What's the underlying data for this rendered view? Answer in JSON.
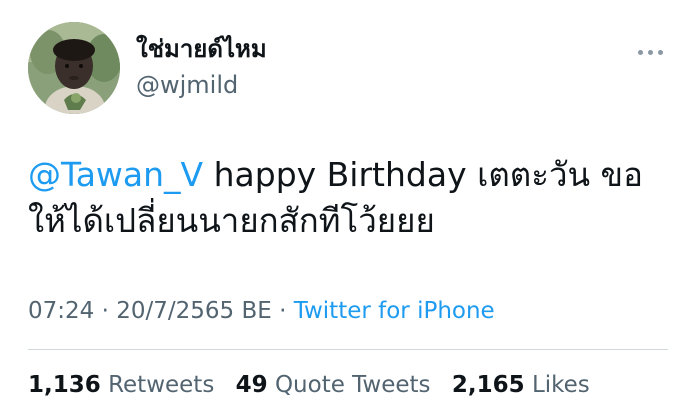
{
  "author": {
    "display_name": "ใช่มายด์ไหม",
    "handle": "@wjmild"
  },
  "tweet": {
    "mention": "@Tawan_V",
    "text_line1": " happy Birthday เตตะวัน ขอ",
    "text_line2": "ให้ได้เปลี่ยนนายกสักทีโว้ยยย"
  },
  "meta": {
    "time": "07:24",
    "separator": " · ",
    "date": "20/7/2565 BE",
    "source": "Twitter for iPhone"
  },
  "stats": {
    "retweets_count": "1,136",
    "retweets_label": "Retweets",
    "quotes_count": "49",
    "quotes_label": "Quote Tweets",
    "likes_count": "2,165",
    "likes_label": "Likes"
  },
  "colors": {
    "link": "#1d9bf0",
    "secondary_text": "#536471",
    "primary_text": "#0f1419",
    "divider": "#cfd9de"
  },
  "icons": {
    "more": "more-horizontal-icon"
  }
}
